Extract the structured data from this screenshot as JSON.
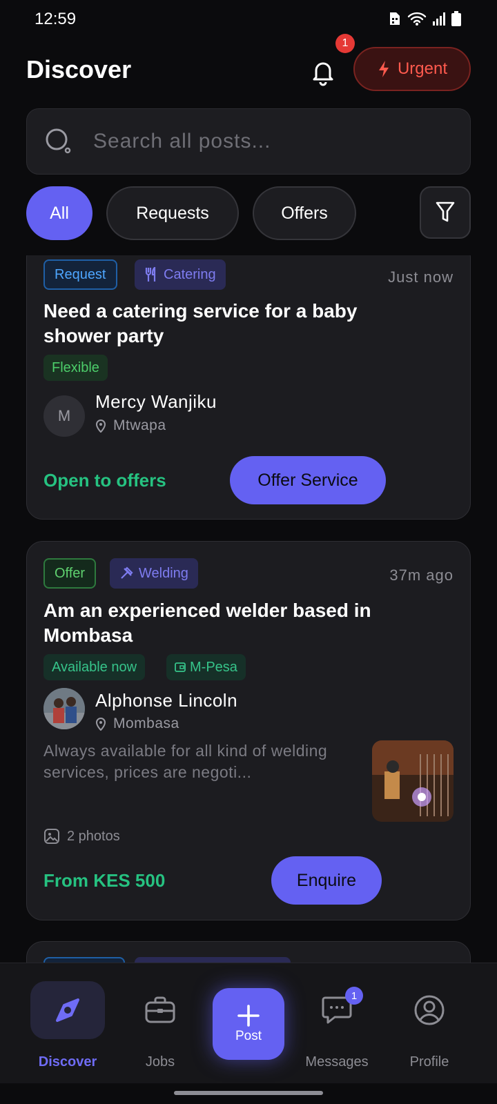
{
  "status_bar": {
    "time": "12:59"
  },
  "header": {
    "title": "Discover",
    "notification_count": "1",
    "urgent_label": "Urgent"
  },
  "search": {
    "placeholder": "Search all posts..."
  },
  "filters": {
    "chips": [
      "All",
      "Requests",
      "Offers"
    ],
    "active": "All"
  },
  "posts": [
    {
      "type_tag": "Request",
      "category": "Catering",
      "time": "Just now",
      "title": "Need a catering service for a baby shower party",
      "availability": "Flexible",
      "user": {
        "initial": "M",
        "name": "Mercy Wanjiku",
        "location": "Mtwapa"
      },
      "price": "Open to offers",
      "cta": "Offer Service"
    },
    {
      "type_tag": "Offer",
      "category": "Welding",
      "time": "37m ago",
      "title": "Am an experienced welder based in Mombasa",
      "availability": "Available now",
      "payment": "M-Pesa",
      "user": {
        "name": "Alphonse Lincoln",
        "location": "Mombasa"
      },
      "description": "Always available for all kind of welding services,  prices are negoti...",
      "photos": "2 photos",
      "price": "From KES 500",
      "cta": "Enquire"
    }
  ],
  "bottom_nav": {
    "items": [
      {
        "label": "Discover",
        "icon": "compass-icon",
        "active": true
      },
      {
        "label": "Jobs",
        "icon": "briefcase-icon"
      },
      {
        "label": "Post",
        "icon": "plus-icon"
      },
      {
        "label": "Messages",
        "icon": "chat-icon",
        "badge": "1"
      },
      {
        "label": "Profile",
        "icon": "user-icon"
      }
    ]
  },
  "colors": {
    "accent": "#6461f2",
    "background": "#0b0b0d",
    "card": "#1c1c20",
    "urgent": "#ff5a4e",
    "price_green": "#26c281"
  }
}
